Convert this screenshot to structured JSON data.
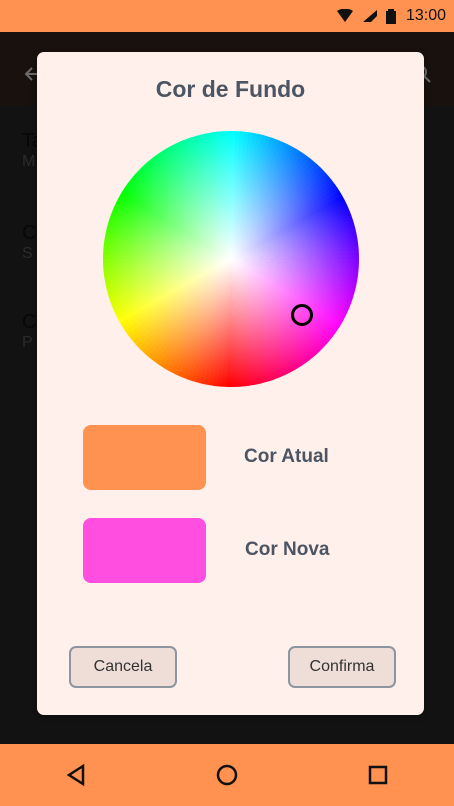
{
  "status_bar": {
    "time": "13:00",
    "wifi_icon": "wifi-icon",
    "signal_icon": "signal-icon",
    "battery_icon": "battery-icon"
  },
  "background_screen": {
    "items": [
      {
        "title": "Ta",
        "subtitle": "M"
      },
      {
        "title": "C",
        "subtitle": "S"
      },
      {
        "title": "C",
        "subtitle": "P"
      }
    ]
  },
  "dialog": {
    "title": "Cor de Fundo",
    "wheel_handle_icon": "color-picker-handle-icon",
    "current_color_label": "Cor Atual",
    "new_color_label": "Cor Nova",
    "cancel_label": "Cancela",
    "confirm_label": "Confirma"
  },
  "colors": {
    "current_color": "#ff9250",
    "new_color": "#ff4ee0",
    "accent": "#ff9250"
  },
  "nav_bar": {
    "back_icon": "back-triangle-icon",
    "home_icon": "home-circle-icon",
    "recents_icon": "recents-square-icon"
  }
}
